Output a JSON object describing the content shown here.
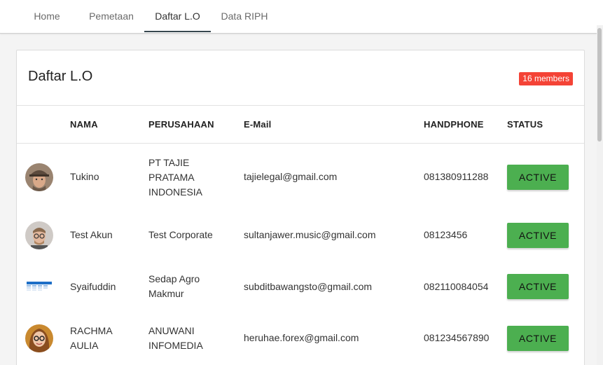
{
  "nav": {
    "tabs": [
      "Home",
      "Pemetaan",
      "Daftar L.O",
      "Data RIPH"
    ],
    "active_index": 2
  },
  "card": {
    "title": "Daftar L.O",
    "badge": "16 members"
  },
  "table": {
    "headers": {
      "nama": "NAMA",
      "perusahaan": "PERUSAHAAN",
      "email": "E-Mail",
      "handphone": "HANDPHONE",
      "status": "STATUS"
    },
    "rows": [
      {
        "nama": "Tukino",
        "perusahaan": "PT TAJIE PRATAMA INDONESIA",
        "email": "tajielegal@gmail.com",
        "handphone": "081380911288",
        "status": "ACTIVE",
        "avatar": "man-with-hat-avatar"
      },
      {
        "nama": "Test Akun",
        "perusahaan": "Test Corporate",
        "email": "sultanjawer.music@gmail.com",
        "handphone": "08123456",
        "status": "ACTIVE",
        "avatar": "man-with-glasses-avatar"
      },
      {
        "nama": "Syaifuddin",
        "perusahaan": "Sedap Agro Makmur",
        "email": "subditbawangsto@gmail.com",
        "handphone": "082110084054",
        "status": "ACTIVE",
        "avatar": "building-avatar"
      },
      {
        "nama": "RACHMA AULIA",
        "perusahaan": "ANUWANI INFOMEDIA",
        "email": "heruhae.forex@gmail.com",
        "handphone": "081234567890",
        "status": "ACTIVE",
        "avatar": "woman-with-glasses-avatar"
      }
    ]
  },
  "colors": {
    "active_button": "#4caf50",
    "badge": "#f44336",
    "tab_indicator": "#37474f"
  }
}
